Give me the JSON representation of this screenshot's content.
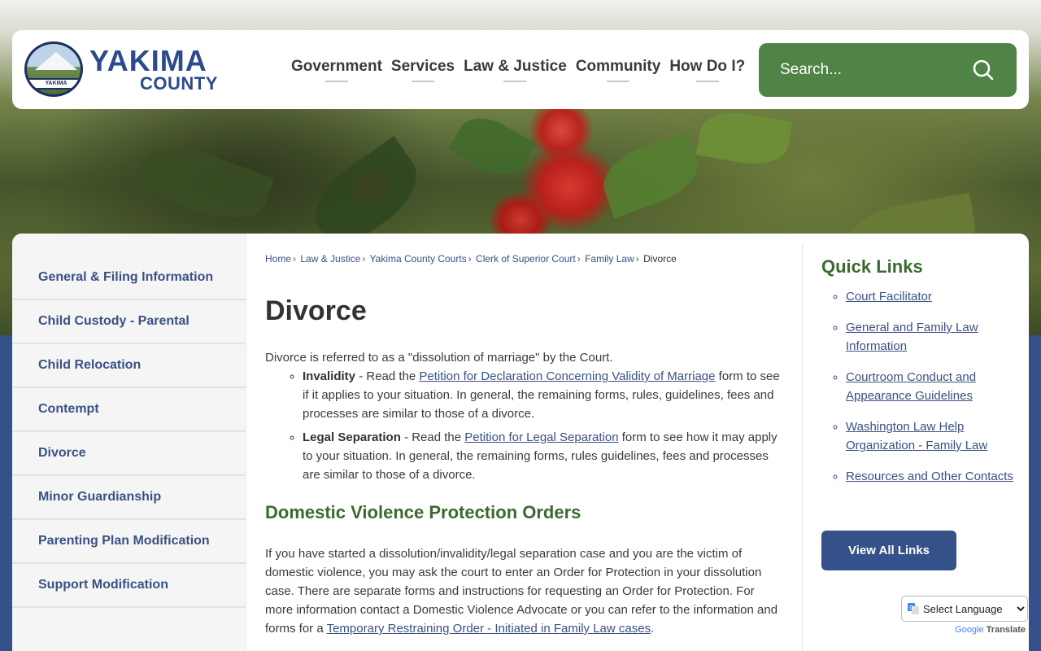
{
  "header": {
    "logo_title": "YAKIMA",
    "logo_subtitle": "COUNTY",
    "logo_ribbon": "YAKIMA",
    "nav": [
      "Government",
      "Services",
      "Law & Justice",
      "Community",
      "How Do I?"
    ],
    "search_placeholder": "Search..."
  },
  "breadcrumb": [
    "Home",
    "Law & Justice",
    "Yakima County Courts",
    "Clerk of Superior Court",
    "Family Law",
    "Divorce"
  ],
  "sidebar": {
    "items": [
      "General & Filing Information",
      "Child Custody - Parental",
      "Child Relocation",
      "Contempt",
      "Divorce",
      "Minor Guardianship",
      "Parenting Plan Modification",
      "Support Modification"
    ]
  },
  "main": {
    "title": "Divorce",
    "intro": "Divorce is referred to as a \"dissolution of marriage\" by the Court.",
    "bullets": [
      {
        "term": "Invalidity",
        "pre": " - Read the ",
        "link": "Petition for Declaration Concerning Validity of Marriage",
        "post": " form to see if it applies to your situation. In general, the remaining forms, rules, guidelines, fees and processes are similar to those of a divorce."
      },
      {
        "term": "Legal Separation",
        "pre": " - Read the ",
        "link": "Petition for Legal Separation",
        "post": " form to see how it may apply to your situation. In general, the remaining forms, rules guidelines, fees and processes are similar to those of a divorce."
      }
    ],
    "section_title": "Domestic Violence Protection Orders",
    "section_text": "If you have started a dissolution/invalidity/legal separation case and you are the victim of domestic violence, you may ask the court to enter an Order for Protection in your dissolution case. There are separate forms and instructions for requesting an Order for Protection. For more information contact a Domestic Violence Advocate or you can refer to the information and forms for a ",
    "section_link": "Temporary Restraining Order - Initiated in Family Law cases",
    "section_end": "."
  },
  "quick_links": {
    "title": "Quick Links",
    "items": [
      "Court Facilitator",
      "General and Family Law Information",
      "Courtroom Conduct and Appearance Guidelines",
      "Washington Law Help Organization - Family Law",
      "Resources and Other Contacts"
    ],
    "button": "View All Links"
  },
  "translate": {
    "select_label": "Select Language",
    "powered_google": "Google",
    "powered_translate": "Translate"
  },
  "colors": {
    "navy": "#34518a",
    "green": "#4f8446",
    "heading_green": "#3a6a2e",
    "link": "#3a5183"
  }
}
